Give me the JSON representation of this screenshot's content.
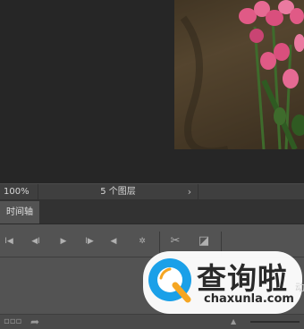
{
  "statusbar": {
    "zoom": "100%",
    "doc_info": "5 个图层",
    "expand_arrow": "›"
  },
  "panel": {
    "tab_label": "时间轴"
  },
  "timeline_controls": {
    "first_frame": "I◀",
    "prev_frame": "◀I",
    "play": "▶",
    "next_frame": "I▶",
    "audio": "◀",
    "settings": "✲",
    "split": "✂",
    "transition": "◪"
  },
  "bottom_bar": {
    "frames_icon": "▫▫▫",
    "convert_icon": "➦",
    "zoom_out_icon": "▲"
  },
  "watermark": {
    "brand": "查询啦",
    "domain": "chaxunla.com",
    "cutoff_text": "动"
  },
  "colors": {
    "accent_blue": "#1aa0e8",
    "accent_orange": "#f5a623",
    "tulip_pink": "#e05a86"
  }
}
